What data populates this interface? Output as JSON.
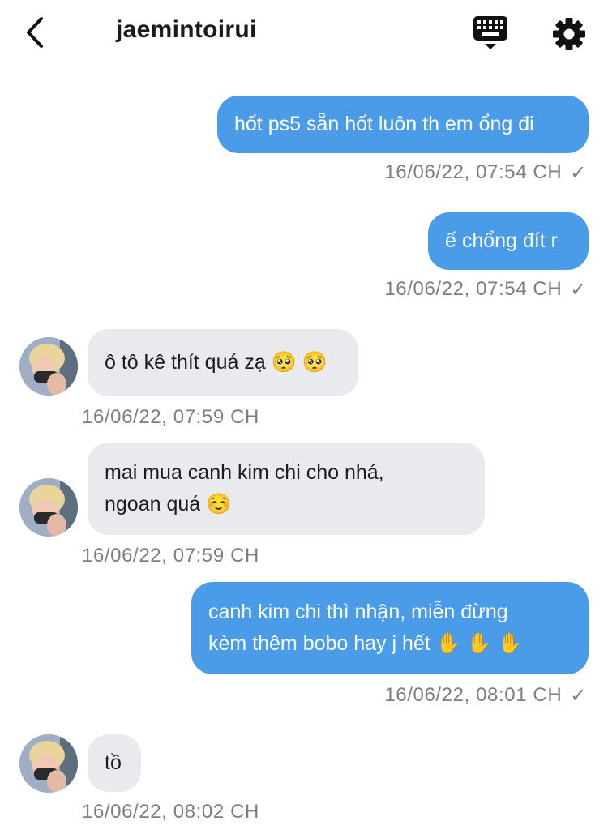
{
  "header": {
    "title": "jaemintoirui",
    "back_icon": "chevron-left-icon",
    "keyboard_icon": "keyboard-icon",
    "settings_icon": "gear-icon"
  },
  "colors": {
    "outgoing_bubble": "#4b9ce8",
    "incoming_bubble": "#e8eaee",
    "timestamp": "#7a7e86"
  },
  "messages": [
    {
      "direction": "out",
      "text": "hốt ps5 sẵn hốt luôn th em ổng đi",
      "time": "16/06/22, 07:54 CH",
      "status": "✓"
    },
    {
      "direction": "out",
      "text": "ế chổng đít r",
      "time": "16/06/22, 07:54 CH",
      "status": "✓"
    },
    {
      "direction": "in",
      "text": "ô tô kê thít quá zạ 🥺 🥺",
      "time": "16/06/22, 07:59 CH"
    },
    {
      "direction": "in",
      "lines": [
        "mai mua canh kim chi cho nhá,",
        "ngoan quá ☺️"
      ],
      "time": "16/06/22, 07:59 CH"
    },
    {
      "direction": "out",
      "lines": [
        "canh kim chi thì nhận, miễn đừng",
        "kèm thêm bobo hay j hết ✋ ✋ ✋"
      ],
      "time": "16/06/22, 08:01 CH",
      "status": "✓"
    },
    {
      "direction": "in",
      "text": "tồ",
      "time": "16/06/22, 08:02 CH"
    }
  ]
}
